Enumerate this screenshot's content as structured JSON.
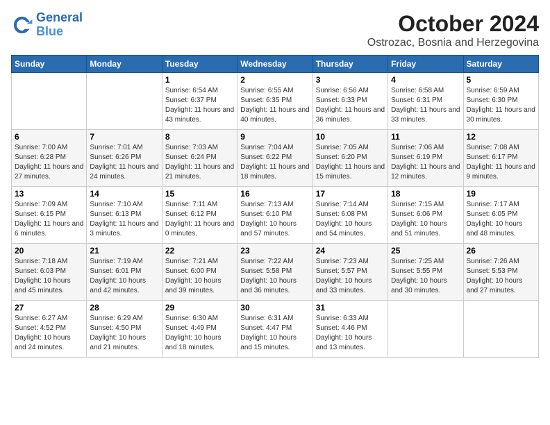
{
  "header": {
    "logo_line1": "General",
    "logo_line2": "Blue",
    "month_year": "October 2024",
    "location": "Ostrozac, Bosnia and Herzegovina"
  },
  "weekdays": [
    "Sunday",
    "Monday",
    "Tuesday",
    "Wednesday",
    "Thursday",
    "Friday",
    "Saturday"
  ],
  "weeks": [
    [
      {
        "day": "",
        "sunrise": "",
        "sunset": "",
        "daylight": ""
      },
      {
        "day": "",
        "sunrise": "",
        "sunset": "",
        "daylight": ""
      },
      {
        "day": "1",
        "sunrise": "Sunrise: 6:54 AM",
        "sunset": "Sunset: 6:37 PM",
        "daylight": "Daylight: 11 hours and 43 minutes."
      },
      {
        "day": "2",
        "sunrise": "Sunrise: 6:55 AM",
        "sunset": "Sunset: 6:35 PM",
        "daylight": "Daylight: 11 hours and 40 minutes."
      },
      {
        "day": "3",
        "sunrise": "Sunrise: 6:56 AM",
        "sunset": "Sunset: 6:33 PM",
        "daylight": "Daylight: 11 hours and 36 minutes."
      },
      {
        "day": "4",
        "sunrise": "Sunrise: 6:58 AM",
        "sunset": "Sunset: 6:31 PM",
        "daylight": "Daylight: 11 hours and 33 minutes."
      },
      {
        "day": "5",
        "sunrise": "Sunrise: 6:59 AM",
        "sunset": "Sunset: 6:30 PM",
        "daylight": "Daylight: 11 hours and 30 minutes."
      }
    ],
    [
      {
        "day": "6",
        "sunrise": "Sunrise: 7:00 AM",
        "sunset": "Sunset: 6:28 PM",
        "daylight": "Daylight: 11 hours and 27 minutes."
      },
      {
        "day": "7",
        "sunrise": "Sunrise: 7:01 AM",
        "sunset": "Sunset: 6:26 PM",
        "daylight": "Daylight: 11 hours and 24 minutes."
      },
      {
        "day": "8",
        "sunrise": "Sunrise: 7:03 AM",
        "sunset": "Sunset: 6:24 PM",
        "daylight": "Daylight: 11 hours and 21 minutes."
      },
      {
        "day": "9",
        "sunrise": "Sunrise: 7:04 AM",
        "sunset": "Sunset: 6:22 PM",
        "daylight": "Daylight: 11 hours and 18 minutes."
      },
      {
        "day": "10",
        "sunrise": "Sunrise: 7:05 AM",
        "sunset": "Sunset: 6:20 PM",
        "daylight": "Daylight: 11 hours and 15 minutes."
      },
      {
        "day": "11",
        "sunrise": "Sunrise: 7:06 AM",
        "sunset": "Sunset: 6:19 PM",
        "daylight": "Daylight: 11 hours and 12 minutes."
      },
      {
        "day": "12",
        "sunrise": "Sunrise: 7:08 AM",
        "sunset": "Sunset: 6:17 PM",
        "daylight": "Daylight: 11 hours and 9 minutes."
      }
    ],
    [
      {
        "day": "13",
        "sunrise": "Sunrise: 7:09 AM",
        "sunset": "Sunset: 6:15 PM",
        "daylight": "Daylight: 11 hours and 6 minutes."
      },
      {
        "day": "14",
        "sunrise": "Sunrise: 7:10 AM",
        "sunset": "Sunset: 6:13 PM",
        "daylight": "Daylight: 11 hours and 3 minutes."
      },
      {
        "day": "15",
        "sunrise": "Sunrise: 7:11 AM",
        "sunset": "Sunset: 6:12 PM",
        "daylight": "Daylight: 11 hours and 0 minutes."
      },
      {
        "day": "16",
        "sunrise": "Sunrise: 7:13 AM",
        "sunset": "Sunset: 6:10 PM",
        "daylight": "Daylight: 10 hours and 57 minutes."
      },
      {
        "day": "17",
        "sunrise": "Sunrise: 7:14 AM",
        "sunset": "Sunset: 6:08 PM",
        "daylight": "Daylight: 10 hours and 54 minutes."
      },
      {
        "day": "18",
        "sunrise": "Sunrise: 7:15 AM",
        "sunset": "Sunset: 6:06 PM",
        "daylight": "Daylight: 10 hours and 51 minutes."
      },
      {
        "day": "19",
        "sunrise": "Sunrise: 7:17 AM",
        "sunset": "Sunset: 6:05 PM",
        "daylight": "Daylight: 10 hours and 48 minutes."
      }
    ],
    [
      {
        "day": "20",
        "sunrise": "Sunrise: 7:18 AM",
        "sunset": "Sunset: 6:03 PM",
        "daylight": "Daylight: 10 hours and 45 minutes."
      },
      {
        "day": "21",
        "sunrise": "Sunrise: 7:19 AM",
        "sunset": "Sunset: 6:01 PM",
        "daylight": "Daylight: 10 hours and 42 minutes."
      },
      {
        "day": "22",
        "sunrise": "Sunrise: 7:21 AM",
        "sunset": "Sunset: 6:00 PM",
        "daylight": "Daylight: 10 hours and 39 minutes."
      },
      {
        "day": "23",
        "sunrise": "Sunrise: 7:22 AM",
        "sunset": "Sunset: 5:58 PM",
        "daylight": "Daylight: 10 hours and 36 minutes."
      },
      {
        "day": "24",
        "sunrise": "Sunrise: 7:23 AM",
        "sunset": "Sunset: 5:57 PM",
        "daylight": "Daylight: 10 hours and 33 minutes."
      },
      {
        "day": "25",
        "sunrise": "Sunrise: 7:25 AM",
        "sunset": "Sunset: 5:55 PM",
        "daylight": "Daylight: 10 hours and 30 minutes."
      },
      {
        "day": "26",
        "sunrise": "Sunrise: 7:26 AM",
        "sunset": "Sunset: 5:53 PM",
        "daylight": "Daylight: 10 hours and 27 minutes."
      }
    ],
    [
      {
        "day": "27",
        "sunrise": "Sunrise: 6:27 AM",
        "sunset": "Sunset: 4:52 PM",
        "daylight": "Daylight: 10 hours and 24 minutes."
      },
      {
        "day": "28",
        "sunrise": "Sunrise: 6:29 AM",
        "sunset": "Sunset: 4:50 PM",
        "daylight": "Daylight: 10 hours and 21 minutes."
      },
      {
        "day": "29",
        "sunrise": "Sunrise: 6:30 AM",
        "sunset": "Sunset: 4:49 PM",
        "daylight": "Daylight: 10 hours and 18 minutes."
      },
      {
        "day": "30",
        "sunrise": "Sunrise: 6:31 AM",
        "sunset": "Sunset: 4:47 PM",
        "daylight": "Daylight: 10 hours and 15 minutes."
      },
      {
        "day": "31",
        "sunrise": "Sunrise: 6:33 AM",
        "sunset": "Sunset: 4:46 PM",
        "daylight": "Daylight: 10 hours and 13 minutes."
      },
      {
        "day": "",
        "sunrise": "",
        "sunset": "",
        "daylight": ""
      },
      {
        "day": "",
        "sunrise": "",
        "sunset": "",
        "daylight": ""
      }
    ]
  ]
}
